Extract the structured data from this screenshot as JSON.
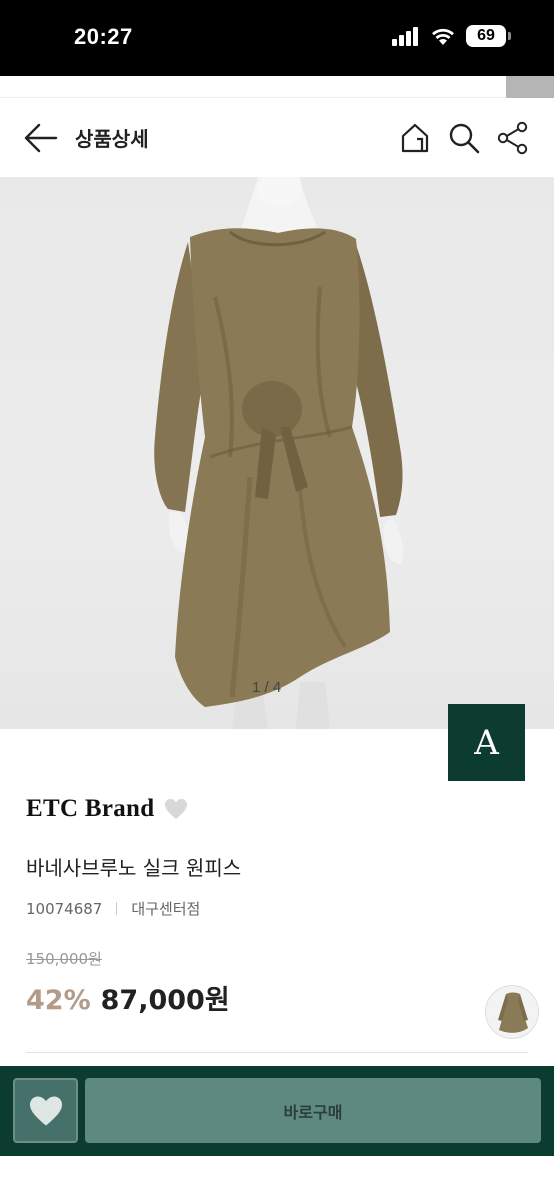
{
  "status": {
    "time": "20:27",
    "battery": "69"
  },
  "header": {
    "title": "상품상세"
  },
  "gallery": {
    "counter": "1 / 4"
  },
  "brand_badge": {
    "letter": "A"
  },
  "product": {
    "brand": "ETC Brand",
    "name": "바네사브루노 실크 원피스",
    "code": "10074687",
    "store": "대구센터점",
    "original_price": "150,000원",
    "discount": "42%",
    "sale_price": "87,000원"
  },
  "actions": {
    "buy_label": "바로구매"
  },
  "colors": {
    "primary": "#0c3b2f",
    "discount": "#b39b8a",
    "buy_button": "#5e8981"
  },
  "icons": [
    "back-arrow-icon",
    "home-icon",
    "search-icon",
    "share-icon",
    "heart-icon"
  ]
}
